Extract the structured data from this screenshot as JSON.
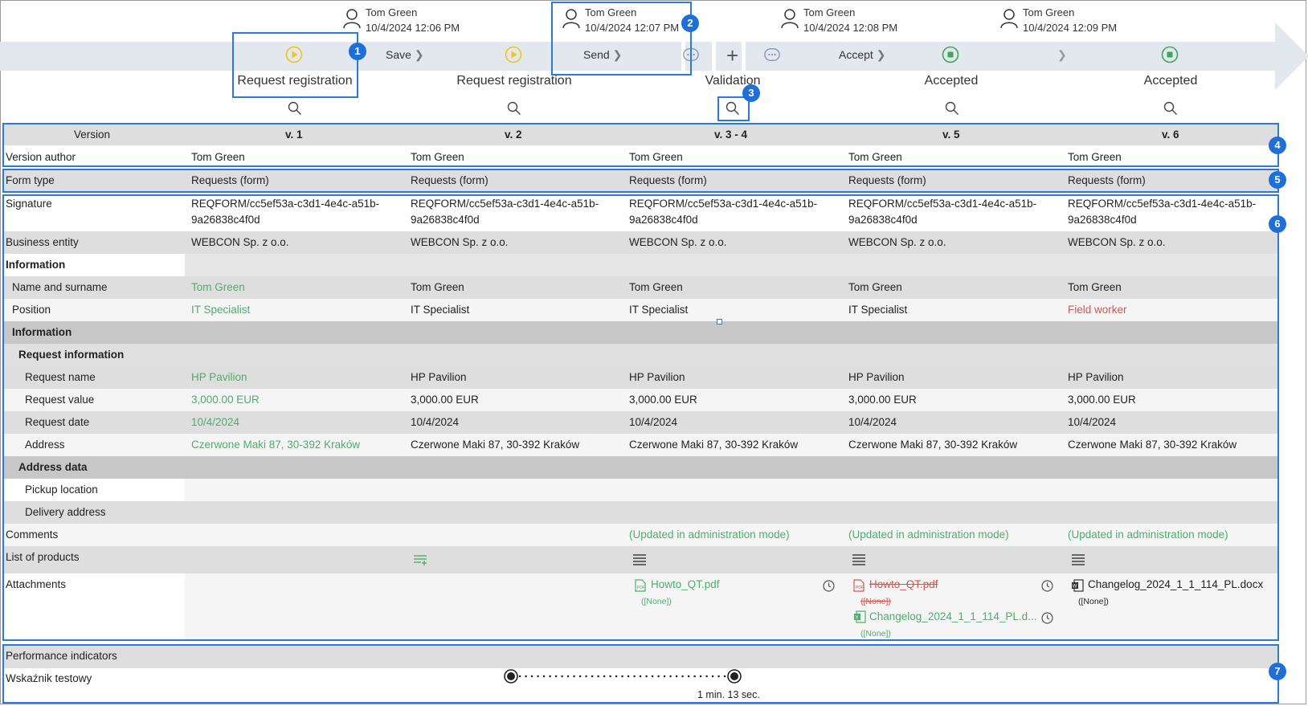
{
  "timeline": {
    "users": [
      {
        "name": "Tom Green",
        "time": "10/4/2024 12:06 PM"
      },
      {
        "name": "Tom Green",
        "time": "10/4/2024 12:07 PM"
      },
      {
        "name": "Tom Green",
        "time": "10/4/2024 12:08 PM"
      },
      {
        "name": "Tom Green",
        "time": "10/4/2024 12:09 PM"
      }
    ],
    "transitions": [
      "Save",
      "Send",
      "Accept"
    ],
    "steps": [
      "Request registration",
      "Request registration",
      "Validation",
      "Accepted",
      "Accepted"
    ],
    "plus_label": "+"
  },
  "badges": [
    "1",
    "2",
    "3",
    "4",
    "5",
    "6",
    "7"
  ],
  "versions": {
    "label": "Version",
    "values": [
      "v. 1",
      "v. 2",
      "v. 3 - 4",
      "v. 5",
      "v. 6"
    ]
  },
  "author": {
    "label": "Version author",
    "values": [
      "Tom Green",
      "Tom Green",
      "Tom Green",
      "Tom Green",
      "Tom Green"
    ]
  },
  "form_type": {
    "label": "Form type",
    "values": [
      "Requests (form)",
      "Requests (form)",
      "Requests (form)",
      "Requests (form)",
      "Requests (form)"
    ]
  },
  "signature": {
    "label": "Signature",
    "line1": "REQFORM/cc5ef53a-c3d1-4e4c-a51b-",
    "line2": "9a26838c4f0d"
  },
  "business_entity": {
    "label": "Business entity",
    "value": "WEBCON Sp. z o.o."
  },
  "information": {
    "label": "Information"
  },
  "name_surname": {
    "label": "Name and surname",
    "value": "Tom Green"
  },
  "position": {
    "label": "Position",
    "value": "IT Specialist",
    "v6": "Field worker"
  },
  "information2": {
    "label": "Information"
  },
  "request_information": {
    "label": "Request information"
  },
  "request_name": {
    "label": "Request name",
    "value": "HP Pavilion"
  },
  "request_value": {
    "label": "Request value",
    "value": "3,000.00 EUR"
  },
  "request_date": {
    "label": "Request date",
    "value": "10/4/2024"
  },
  "address": {
    "label": "Address",
    "value": "Czerwone Maki 87, 30-392 Kraków"
  },
  "address_data": {
    "label": "Address data"
  },
  "pickup": {
    "label": "Pickup location"
  },
  "delivery": {
    "label": "Delivery address"
  },
  "comments": {
    "label": "Comments",
    "value": "(Updated in administration mode)"
  },
  "products": {
    "label": "List of products"
  },
  "attachments": {
    "label": "Attachments",
    "v3": {
      "file": "Howto_QT.pdf",
      "desc": "([None])"
    },
    "v5": [
      {
        "file": "Howto_QT.pdf",
        "desc": "([None])"
      },
      {
        "file": "Changelog_2024_1_1_114_PL.d...",
        "desc": "([None])"
      }
    ],
    "v6": {
      "file": "Changelog_2024_1_1_114_PL.docx",
      "desc": "([None])"
    }
  },
  "performance": {
    "label": "Performance indicators"
  },
  "indicator": {
    "label": "Wskaźnik testowy",
    "duration": "1 min. 13 sec."
  },
  "colors": {
    "accent": "#2a7ad8",
    "green": "#4caf6a",
    "red": "#d9534f",
    "yellow": "#f0c419",
    "band": "#e3e8ee",
    "row_gray": "#dedede"
  }
}
